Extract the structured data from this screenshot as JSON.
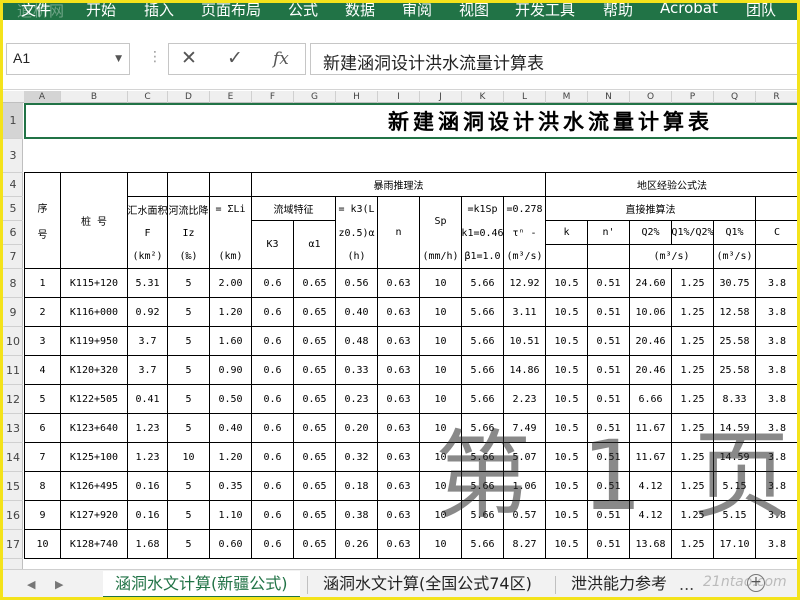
{
  "ribbon": {
    "watermark": "道桥网",
    "tabs": [
      "文件",
      "开始",
      "插入",
      "页面布局",
      "公式",
      "数据",
      "审阅",
      "视图",
      "开发工具",
      "帮助",
      "Acrobat",
      "团队"
    ]
  },
  "formula_bar": {
    "name_box": "A1",
    "cancel_icon": "✕",
    "enter_icon": "✓",
    "fx_label": "fx",
    "content": "新建涵洞设计洪水流量计算表"
  },
  "grid": {
    "columns": [
      "A",
      "B",
      "C",
      "D",
      "E",
      "F",
      "G",
      "H",
      "I",
      "J",
      "K",
      "L",
      "M",
      "N",
      "O",
      "P",
      "Q",
      "R"
    ],
    "rows": [
      "1",
      "3",
      "4",
      "5",
      "6",
      "7",
      "8",
      "9",
      "10",
      "11",
      "12",
      "13",
      "14",
      "15",
      "16",
      "17"
    ]
  },
  "sheet": {
    "title": "新建涵洞设计洪水流量计算表",
    "headers": {
      "seq": "序\n\n号",
      "station": "桩        号",
      "area_top": "汇水面积",
      "area_sym": "F",
      "area_unit": "(km²)",
      "slope_top": "河流比降",
      "slope_sym": "Iz",
      "slope_unit": "(‰)",
      "length_top": "= ΣLi",
      "length_unit": "(km)",
      "rain_group": "暴雨推理法",
      "basin": "流域特征",
      "k3": "K3",
      "alpha": "α1",
      "tau_top": "= k3(L",
      "tau_mid": "z0.5)α",
      "tau_unit": "(h)",
      "n": "n",
      "sp": "Sp",
      "sp_unit": "(mm/h)",
      "q_top1": "=k1Sp",
      "q_top2": "=0.278",
      "q_mid1": "k1=0.46",
      "q_mid2": "τⁿ -",
      "q_bot1": "β1=1.0",
      "q_unit": "(m³/s)",
      "region_group": "地区经验公式法",
      "direct": "直接推算法",
      "k": "k",
      "n2": "n'",
      "q2": "Q2%",
      "q1q2": "Q1%/Q2%",
      "q1": "Q1%",
      "c": "C",
      "q2_unit": "(m³/s)",
      "q1_unit": "(m³/s)"
    },
    "rows": [
      {
        "no": "1",
        "station": "K115+120",
        "F": "5.31",
        "Iz": "5",
        "L": "2.00",
        "K3": "0.6",
        "a1": "0.65",
        "tau": "0.56",
        "n": "0.63",
        "Sp": "10",
        "x": "5.66",
        "Q": "12.92",
        "k": "10.5",
        "n2": "0.51",
        "Q2": "24.60",
        "ratio": "1.25",
        "Q1": "30.75",
        "C": "3.8"
      },
      {
        "no": "2",
        "station": "K116+000",
        "F": "0.92",
        "Iz": "5",
        "L": "1.20",
        "K3": "0.6",
        "a1": "0.65",
        "tau": "0.40",
        "n": "0.63",
        "Sp": "10",
        "x": "5.66",
        "Q": "3.11",
        "k": "10.5",
        "n2": "0.51",
        "Q2": "10.06",
        "ratio": "1.25",
        "Q1": "12.58",
        "C": "3.8"
      },
      {
        "no": "3",
        "station": "K119+950",
        "F": "3.7",
        "Iz": "5",
        "L": "1.60",
        "K3": "0.6",
        "a1": "0.65",
        "tau": "0.48",
        "n": "0.63",
        "Sp": "10",
        "x": "5.66",
        "Q": "10.51",
        "k": "10.5",
        "n2": "0.51",
        "Q2": "20.46",
        "ratio": "1.25",
        "Q1": "25.58",
        "C": "3.8"
      },
      {
        "no": "4",
        "station": "K120+320",
        "F": "3.7",
        "Iz": "5",
        "L": "0.90",
        "K3": "0.6",
        "a1": "0.65",
        "tau": "0.33",
        "n": "0.63",
        "Sp": "10",
        "x": "5.66",
        "Q": "14.86",
        "k": "10.5",
        "n2": "0.51",
        "Q2": "20.46",
        "ratio": "1.25",
        "Q1": "25.58",
        "C": "3.8"
      },
      {
        "no": "5",
        "station": "K122+505",
        "F": "0.41",
        "Iz": "5",
        "L": "0.50",
        "K3": "0.6",
        "a1": "0.65",
        "tau": "0.23",
        "n": "0.63",
        "Sp": "10",
        "x": "5.66",
        "Q": "2.23",
        "k": "10.5",
        "n2": "0.51",
        "Q2": "6.66",
        "ratio": "1.25",
        "Q1": "8.33",
        "C": "3.8"
      },
      {
        "no": "6",
        "station": "K123+640",
        "F": "1.23",
        "Iz": "5",
        "L": "0.40",
        "K3": "0.6",
        "a1": "0.65",
        "tau": "0.20",
        "n": "0.63",
        "Sp": "10",
        "x": "5.66",
        "Q": "7.49",
        "k": "10.5",
        "n2": "0.51",
        "Q2": "11.67",
        "ratio": "1.25",
        "Q1": "14.59",
        "C": "3.8"
      },
      {
        "no": "7",
        "station": "K125+100",
        "F": "1.23",
        "Iz": "10",
        "L": "1.20",
        "K3": "0.6",
        "a1": "0.65",
        "tau": "0.32",
        "n": "0.63",
        "Sp": "10",
        "x": "5.66",
        "Q": "5.07",
        "k": "10.5",
        "n2": "0.51",
        "Q2": "11.67",
        "ratio": "1.25",
        "Q1": "14.59",
        "C": "3.8"
      },
      {
        "no": "8",
        "station": "K126+495",
        "F": "0.16",
        "Iz": "5",
        "L": "0.35",
        "K3": "0.6",
        "a1": "0.65",
        "tau": "0.18",
        "n": "0.63",
        "Sp": "10",
        "x": "5.66",
        "Q": "1.06",
        "k": "10.5",
        "n2": "0.51",
        "Q2": "4.12",
        "ratio": "1.25",
        "Q1": "5.15",
        "C": "3.8"
      },
      {
        "no": "9",
        "station": "K127+920",
        "F": "0.16",
        "Iz": "5",
        "L": "1.10",
        "K3": "0.6",
        "a1": "0.65",
        "tau": "0.38",
        "n": "0.63",
        "Sp": "10",
        "x": "5.66",
        "Q": "0.57",
        "k": "10.5",
        "n2": "0.51",
        "Q2": "4.12",
        "ratio": "1.25",
        "Q1": "5.15",
        "C": "3.8"
      },
      {
        "no": "10",
        "station": "K128+740",
        "F": "1.68",
        "Iz": "5",
        "L": "0.60",
        "K3": "0.6",
        "a1": "0.65",
        "tau": "0.26",
        "n": "0.63",
        "Sp": "10",
        "x": "5.66",
        "Q": "8.27",
        "k": "10.5",
        "n2": "0.51",
        "Q2": "13.68",
        "ratio": "1.25",
        "Q1": "17.10",
        "C": "3.8"
      }
    ]
  },
  "watermark_page": "第 1 页",
  "sheet_tabs": {
    "tabs": [
      "涵洞水文计算(新疆公式)",
      "涵洞水文计算(全国公式74区)",
      "泄洪能力参考"
    ],
    "active": 0,
    "more": "...",
    "plus": "+",
    "site_mark": "21ntao.com"
  }
}
